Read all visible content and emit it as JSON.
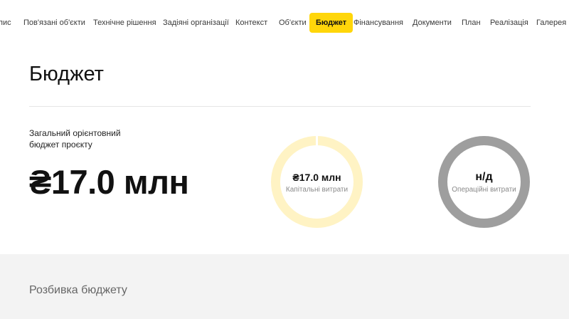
{
  "nav": {
    "items": [
      {
        "label": "пис"
      },
      {
        "label": "Пов'язані об'єкти"
      },
      {
        "label": "Технічне рішення"
      },
      {
        "label": "Задіяні організації"
      },
      {
        "label": "Контекст"
      },
      {
        "label": "Об'єкти"
      },
      {
        "label": "Бюджет",
        "active": true
      },
      {
        "label": "Фінансування"
      },
      {
        "label": "Документи"
      },
      {
        "label": "План"
      },
      {
        "label": "Реалізація"
      },
      {
        "label": "Галерея"
      }
    ]
  },
  "budget": {
    "title": "Бюджет",
    "total_label": "Загальний орієнтовний бюджет проєкту",
    "total_value": "₴17.0 млн",
    "capital": {
      "value": "₴17.0 млн",
      "label": "Капітальні витрати",
      "share": 1.0,
      "color": "#fff3c4"
    },
    "operational": {
      "value": "н/д",
      "label": "Операційні витрати",
      "share": 1.0,
      "color": "#9e9e9e"
    }
  },
  "breakdown": {
    "title": "Розбивка бюджету"
  },
  "colors": {
    "accent": "#ffd60a",
    "bottom_background": "#f3f3f3"
  }
}
